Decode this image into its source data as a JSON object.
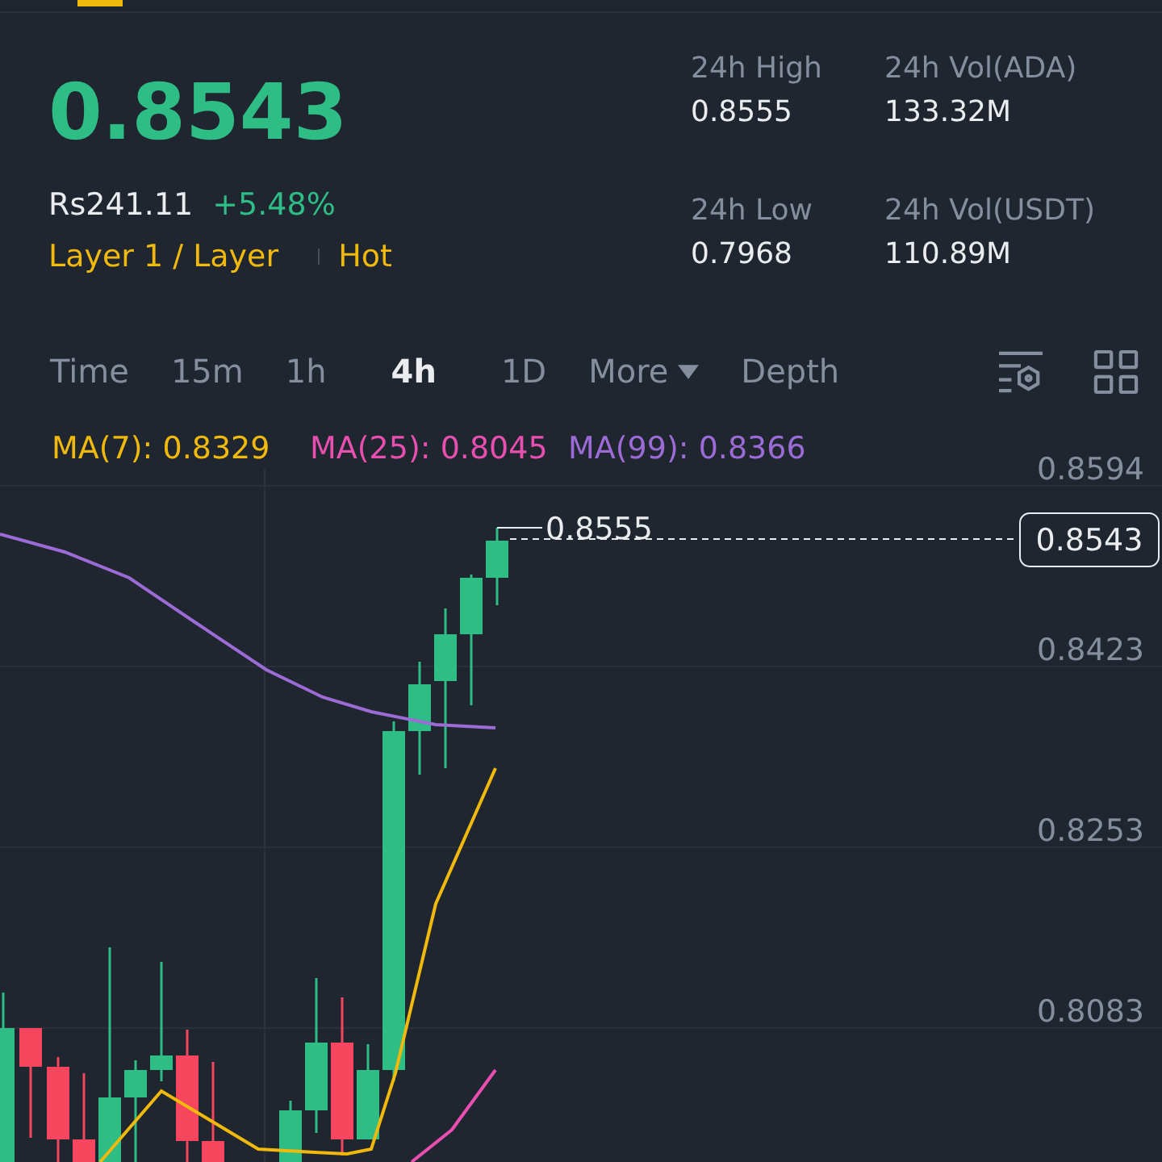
{
  "price": "0.8543",
  "fiat_price": "Rs241.11",
  "change": "+5.48%",
  "tags": [
    "Layer 1 / Layer",
    "Hot"
  ],
  "stats": [
    {
      "label": "24h High",
      "value": "0.8555"
    },
    {
      "label": "24h Vol(ADA)",
      "value": "133.32M"
    },
    {
      "label": "24h Low",
      "value": "0.7968"
    },
    {
      "label": "24h Vol(USDT)",
      "value": "110.89M"
    }
  ],
  "intervals": [
    {
      "label": "Time",
      "selected": false,
      "kind": "plain"
    },
    {
      "label": "15m",
      "selected": false,
      "kind": "plain"
    },
    {
      "label": "1h",
      "selected": false,
      "kind": "plain"
    },
    {
      "label": "4h",
      "selected": true,
      "kind": "plain"
    },
    {
      "label": "1D",
      "selected": false,
      "kind": "plain"
    },
    {
      "label": "More",
      "selected": false,
      "kind": "dropdown"
    },
    {
      "label": "Depth",
      "selected": false,
      "kind": "plain"
    }
  ],
  "chart": {
    "ma_legend": [
      {
        "label": "MA(7): 0.8329",
        "color": "#f0b90b"
      },
      {
        "label": "MA(25): 0.8045",
        "color": "#e84fb0"
      },
      {
        "label": "MA(99): 0.8366",
        "color": "#9c6bd6"
      }
    ],
    "price_axis": [
      "0.8594",
      "0.8423",
      "0.8253",
      "0.8083"
    ],
    "high_marker": "0.8555",
    "last_price": "0.8543"
  }
}
